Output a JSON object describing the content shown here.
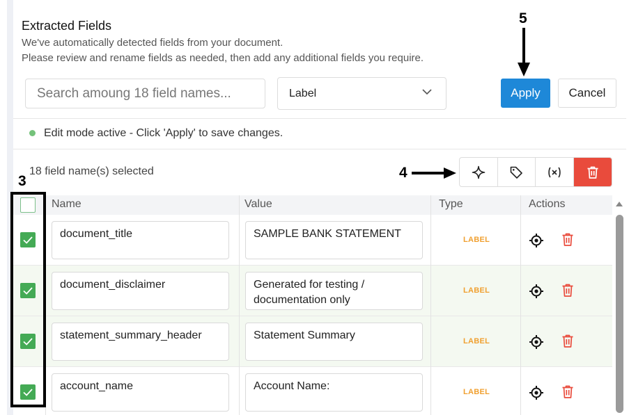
{
  "header": {
    "title": "Extracted Fields",
    "description_line1": "We've automatically detected fields from your document.",
    "description_line2": "Please review and rename fields as needed, then add any additional fields you require."
  },
  "search": {
    "placeholder": "Search amoung 18 field names..."
  },
  "filter_select": {
    "value": "Label"
  },
  "buttons": {
    "apply": "Apply",
    "cancel": "Cancel"
  },
  "status": {
    "text": "Edit mode active - Click 'Apply' to save changes."
  },
  "selection": {
    "count_text": "18 field name(s) selected"
  },
  "toolbar_icons": [
    "sparkle-icon",
    "tag-icon",
    "variable-icon",
    "trash-icon"
  ],
  "table": {
    "columns": [
      "Name",
      "Value",
      "Type",
      "Actions"
    ],
    "rows": [
      {
        "name": "document_title",
        "value": "SAMPLE BANK STATEMENT",
        "type": "LABEL",
        "checked": true
      },
      {
        "name": "document_disclaimer",
        "value": "Generated for testing / documentation only",
        "type": "LABEL",
        "checked": true
      },
      {
        "name": "statement_summary_header",
        "value": "Statement Summary",
        "type": "LABEL",
        "checked": true
      },
      {
        "name": "account_name",
        "value": "Account Name:",
        "type": "LABEL",
        "checked": true
      }
    ]
  },
  "annotations": {
    "label_3": "3",
    "label_4": "4",
    "label_5": "5"
  },
  "colors": {
    "accent": "#1e88d8",
    "danger": "#e94b3c",
    "check": "#44aa55",
    "badge": "#f0a030"
  }
}
